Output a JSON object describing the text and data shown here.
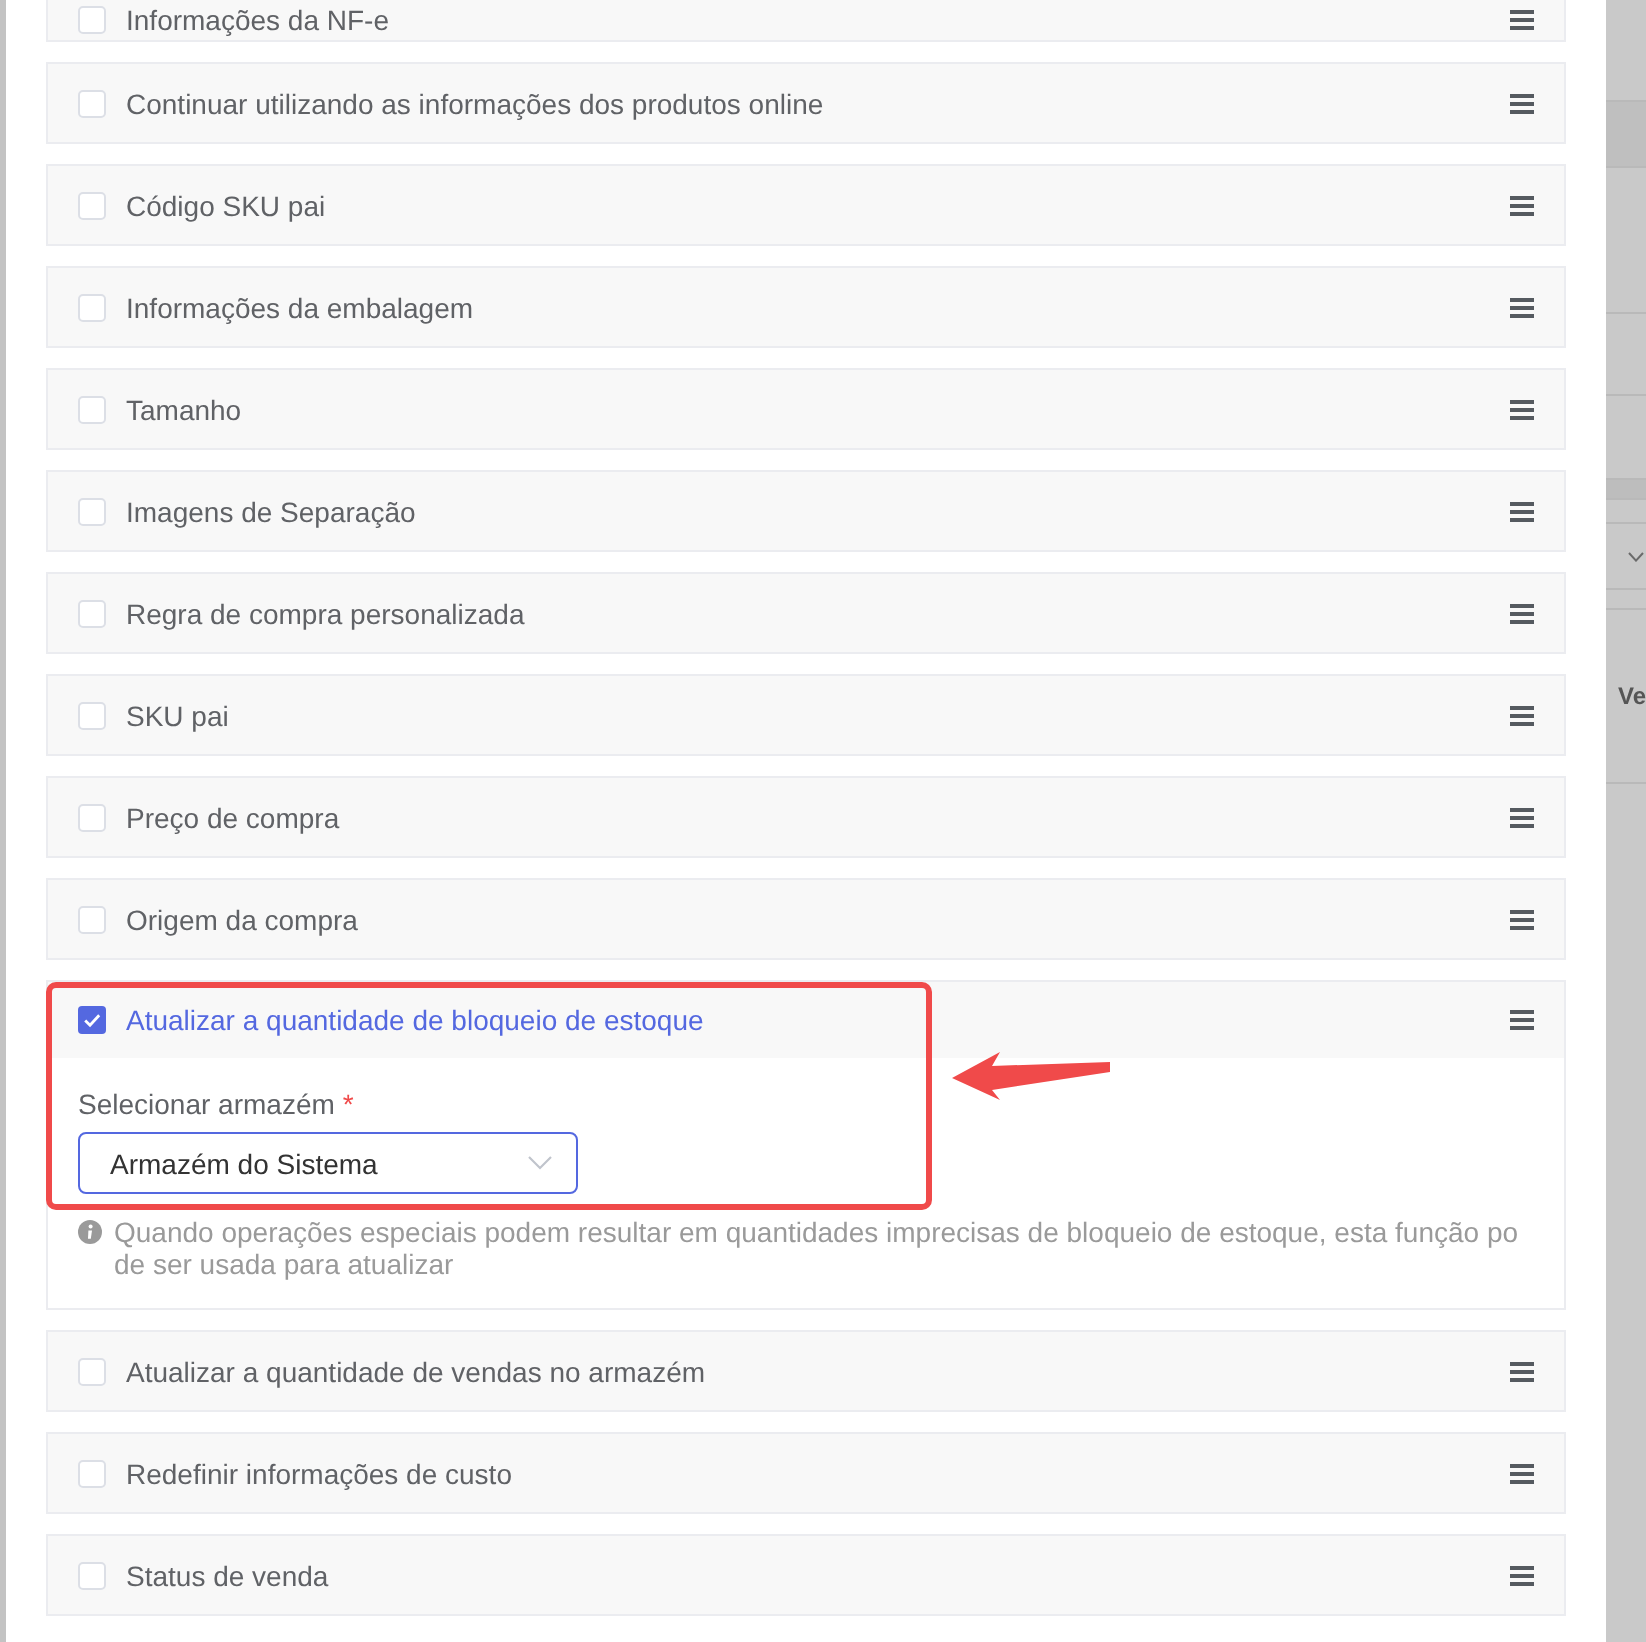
{
  "items": [
    {
      "label": "Informações da NF-e",
      "checked": false,
      "expanded": false,
      "highlighted": false
    },
    {
      "label": "Continuar utilizando as informações dos produtos online",
      "checked": false,
      "expanded": false,
      "highlighted": false
    },
    {
      "label": "Código SKU pai",
      "checked": false,
      "expanded": false,
      "highlighted": false
    },
    {
      "label": "Informações da embalagem",
      "checked": false,
      "expanded": false,
      "highlighted": false
    },
    {
      "label": "Tamanho",
      "checked": false,
      "expanded": false,
      "highlighted": false
    },
    {
      "label": "Imagens de Separação",
      "checked": false,
      "expanded": false,
      "highlighted": false
    },
    {
      "label": "Regra de compra personalizada",
      "checked": false,
      "expanded": false,
      "highlighted": false
    },
    {
      "label": "SKU pai",
      "checked": false,
      "expanded": false,
      "highlighted": false
    },
    {
      "label": "Preço de compra",
      "checked": false,
      "expanded": false,
      "highlighted": false
    },
    {
      "label": "Origem da compra",
      "checked": false,
      "expanded": false,
      "highlighted": false
    },
    {
      "label": "Atualizar a quantidade de bloqueio de estoque",
      "checked": true,
      "expanded": true,
      "highlighted": true,
      "warehouse_field": {
        "label": "Selecionar armazém",
        "required_mark": "*",
        "value": "Armazém do Sistema"
      },
      "hint": "Quando operações especiais podem resultar em quantidades imprecisas de bloqueio de estoque, esta função pode ser usada para atualizar"
    },
    {
      "label": "Atualizar a quantidade de vendas no armazém",
      "checked": false,
      "expanded": false,
      "highlighted": false
    },
    {
      "label": "Redefinir informações de custo",
      "checked": false,
      "expanded": false,
      "highlighted": false
    },
    {
      "label": "Status de venda",
      "checked": false,
      "expanded": false,
      "highlighted": false
    }
  ],
  "backdrop": {
    "text_fragment": "Ve"
  }
}
